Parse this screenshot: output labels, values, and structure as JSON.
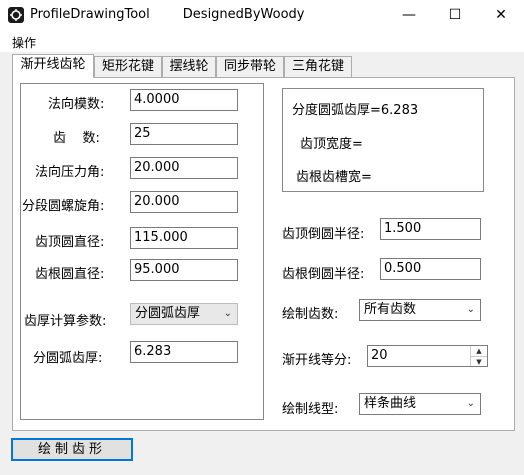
{
  "window": {
    "title": "ProfileDrawingTool        DesignedByWoody",
    "minimize_glyph": "—",
    "maximize_glyph": "☐",
    "close_glyph": "✕"
  },
  "menu": {
    "operate": "操作"
  },
  "tabs": [
    {
      "label": "渐开线齿轮",
      "active": true
    },
    {
      "label": "矩形花键"
    },
    {
      "label": "摆线轮"
    },
    {
      "label": "同步带轮"
    },
    {
      "label": "三角花键"
    }
  ],
  "left": {
    "normal_module": {
      "label": "法向模数:",
      "value": "4.0000"
    },
    "teeth": {
      "label": "齿    数:",
      "value": "25"
    },
    "normal_pressure_angle": {
      "label": "法向压力角:",
      "value": "20.000"
    },
    "pitch_helix_angle": {
      "label": "分段圆螺旋角:",
      "value": "20.000"
    },
    "tip_diameter": {
      "label": "齿顶圆直径:",
      "value": "115.000"
    },
    "root_diameter": {
      "label": "齿根圆直径:",
      "value": "95.000"
    },
    "thickness_param": {
      "label": "齿厚计算参数:",
      "value": "分圆弧齿厚"
    },
    "arc_thickness": {
      "label": "分圆弧齿厚:",
      "value": "6.283"
    }
  },
  "info": {
    "line1": "分度圆弧齿厚=6.283",
    "line2": "齿顶宽度=",
    "line3": "齿根齿槽宽="
  },
  "right": {
    "tip_fillet": {
      "label": "齿顶倒圆半径:",
      "value": "1.500"
    },
    "root_fillet": {
      "label": "齿根倒圆半径:",
      "value": "0.500"
    },
    "draw_teeth": {
      "label": "绘制齿数:",
      "value": "所有齿数"
    },
    "involute_div": {
      "label": "渐开线等分:",
      "value": "20"
    },
    "line_type": {
      "label": "绘制线型:",
      "value": "样条曲线"
    }
  },
  "actions": {
    "draw_profile": "绘制齿形"
  }
}
